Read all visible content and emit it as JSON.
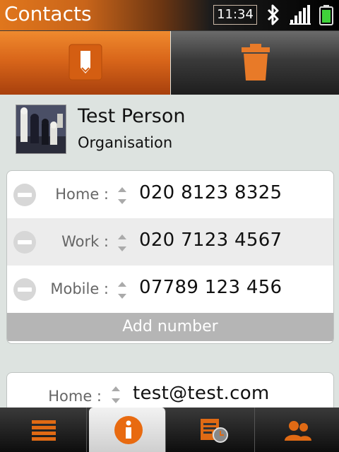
{
  "status": {
    "app_title": "Contacts",
    "clock": "11:34",
    "icons": [
      "bluetooth-icon",
      "signal-icon",
      "battery-icon"
    ]
  },
  "toolbar": {
    "edit_icon": "edit-icon",
    "delete_icon": "trash-icon"
  },
  "contact": {
    "name": "Test Person",
    "organisation": "Organisation",
    "avatar": "chess-pieces-photo"
  },
  "phones": [
    {
      "label": "Home :",
      "value": "020 8123 8325"
    },
    {
      "label": "Work :",
      "value": "020 7123 4567"
    },
    {
      "label": "Mobile :",
      "value": "07789 123 456"
    }
  ],
  "add_number_label": "Add number",
  "emails": [
    {
      "label": "Home :",
      "value": "test@test.com"
    }
  ],
  "bottom_nav": {
    "tabs": [
      "list-icon",
      "info-icon",
      "history-icon",
      "people-icon"
    ],
    "active_index": 1
  },
  "colors": {
    "accent": "#e0761c",
    "background": "#dde3e0"
  }
}
